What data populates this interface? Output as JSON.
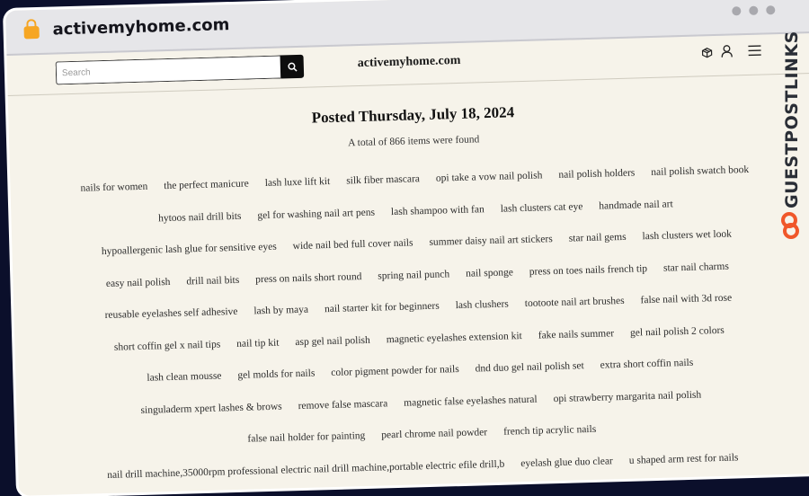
{
  "browser": {
    "url": "activemyhome.com",
    "lock_icon": "lock-icon",
    "window_controls": [
      "dot",
      "dot",
      "dot"
    ]
  },
  "header": {
    "search_placeholder": "Search",
    "search_value": "",
    "search_button_icon": "search-icon",
    "site_title": "activemyhome.com",
    "icons": [
      "box-icon",
      "user-icon",
      "menu-icon"
    ]
  },
  "main": {
    "posted": "Posted Thursday, July 18, 2024",
    "total": "A total of 866 items were found",
    "tags": [
      "nails for women",
      "the perfect manicure",
      "lash luxe lift kit",
      "silk fiber mascara",
      "opi take a vow nail polish",
      "nail polish holders",
      "nail polish swatch book",
      "hytoos nail drill bits",
      "gel for washing nail art pens",
      "lash shampoo with fan",
      "lash clusters cat eye",
      "handmade nail art",
      "hypoallergenic lash glue for sensitive eyes",
      "wide nail bed full cover nails",
      "summer daisy nail art stickers",
      "star nail gems",
      "lash clusters wet look",
      "easy nail polish",
      "drill nail bits",
      "press on nails short round",
      "spring nail punch",
      "nail sponge",
      "press on toes nails french tip",
      "star nail charms",
      "reusable eyelashes self adhesive",
      "lash by maya",
      "nail starter kit for beginners",
      "lash clushers",
      "tootoote nail art brushes",
      "false nail with 3d rose",
      "short coffin gel x nail tips",
      "nail tip kit",
      "asp gel nail polish",
      "magnetic eyelashes extension kit",
      "fake nails summer",
      "gel nail polish 2 colors",
      "lash clean mousse",
      "gel molds for nails",
      "color pigment powder for nails",
      "dnd duo gel nail polish set",
      "extra short coffin nails",
      "singuladerm xpert lashes & brows",
      "remove false mascara",
      "magnetic false eyelashes natural",
      "opi strawberry margarita nail polish",
      "false nail holder for painting",
      "pearl chrome nail powder",
      "french tip acrylic nails",
      "nail drill machine,35000rpm professional electric nail drill machine,portable electric efile drill,b",
      "eyelash glue duo clear",
      "u shaped arm rest for nails"
    ]
  },
  "badge": {
    "text": "GUESTPOSTLINKS",
    "logo_icon": "link-chain-icon",
    "accent_color": "#f0572a"
  }
}
